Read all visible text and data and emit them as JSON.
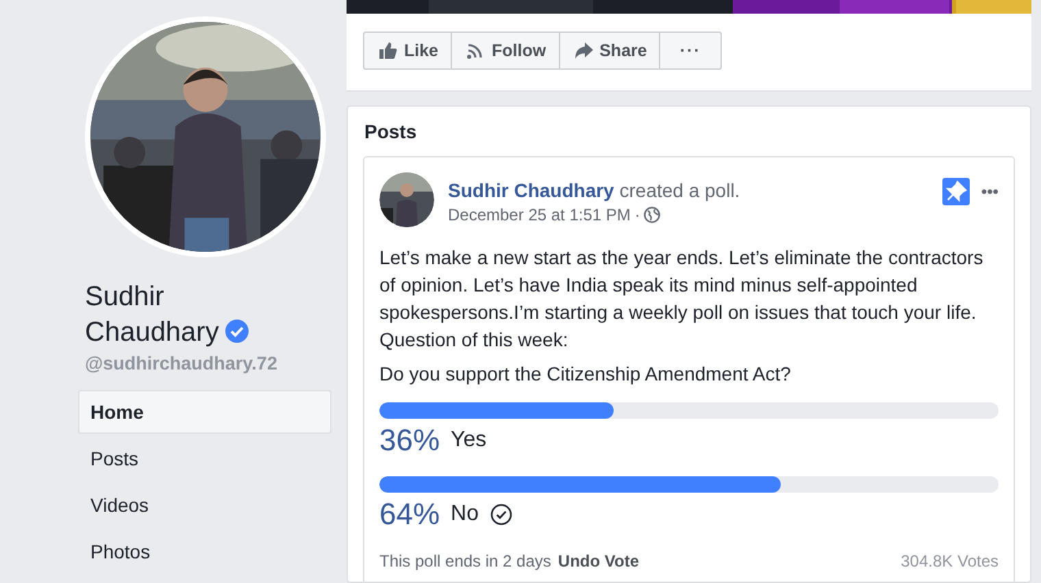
{
  "profile": {
    "name": "Sudhir Chaudhary",
    "verified": true,
    "handle": "@sudhirchaudhary.72"
  },
  "nav": [
    {
      "label": "Home",
      "selected": true
    },
    {
      "label": "Posts",
      "selected": false
    },
    {
      "label": "Videos",
      "selected": false
    },
    {
      "label": "Photos",
      "selected": false
    }
  ],
  "actions": [
    {
      "kind": "like",
      "label": "Like"
    },
    {
      "kind": "follow",
      "label": "Follow"
    },
    {
      "kind": "share",
      "label": "Share"
    },
    {
      "kind": "more",
      "label": "···"
    }
  ],
  "posts_section": {
    "title": "Posts",
    "post": {
      "author": "Sudhir Chaudhary",
      "action": "created a poll.",
      "time": "December 25 at 1:51 PM",
      "separator": "·",
      "pinned": true,
      "menu": "•••",
      "body": "Let’s make a new start as the year ends. Let’s eliminate the contractors of opinion. Let’s have India speak its mind minus self-appointed spokespersons.I’m starting a weekly poll on issues that touch your life. Question of this week:",
      "poll": {
        "question": "Do you support the Citizenship Amendment Act?",
        "options": [
          {
            "percent": "36%",
            "label": "Yes",
            "level": 0.378,
            "voted": false
          },
          {
            "percent": "64%",
            "label": "No",
            "level": 0.649,
            "voted": true
          }
        ],
        "ends": "This poll ends in 2 days",
        "undo": "Undo Vote",
        "votes": "304.8K Votes"
      }
    }
  }
}
